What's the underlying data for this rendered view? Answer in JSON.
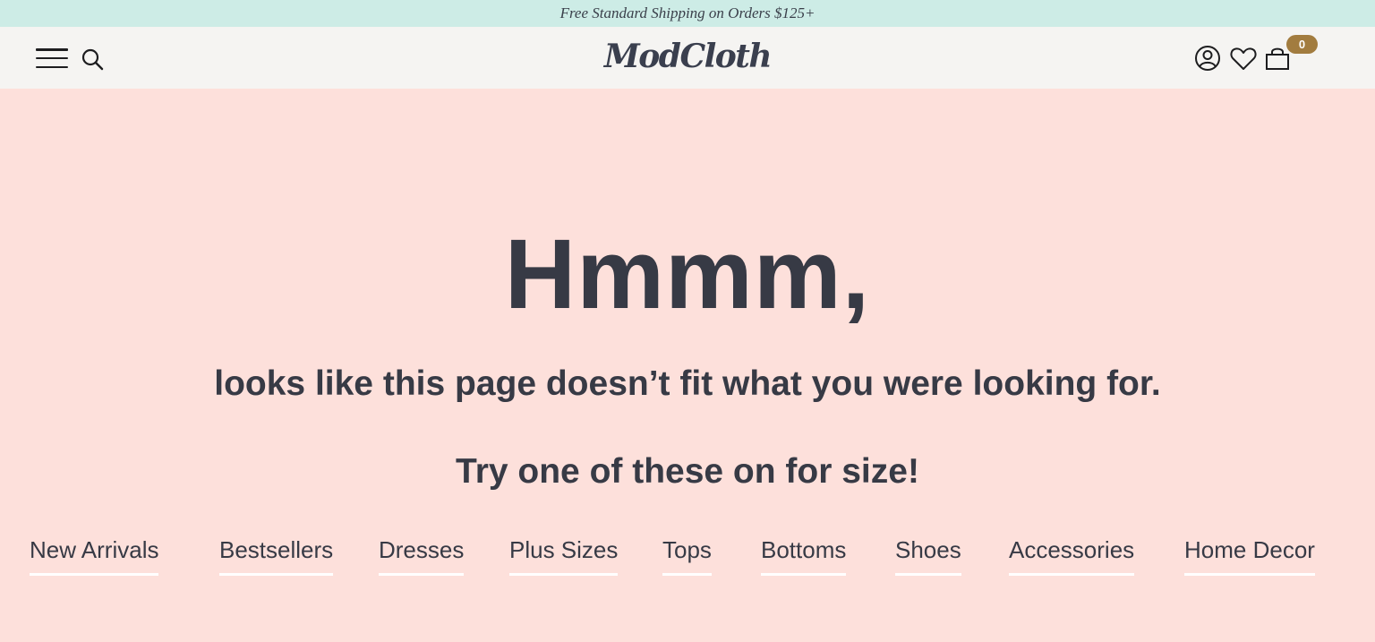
{
  "promo": {
    "text": "Free Standard Shipping on Orders $125+"
  },
  "header": {
    "logo": "ModCloth",
    "cart_count": "0",
    "icons": [
      "menu-icon",
      "search-icon",
      "account-icon",
      "heart-icon",
      "bag-icon"
    ]
  },
  "main": {
    "headline": "Hmmm,",
    "subhead": "looks like this page doesn’t fit what you were looking for.",
    "try_line": "Try one of these on for size!"
  },
  "links": [
    {
      "label": "New Arrivals"
    },
    {
      "label": "Bestsellers"
    },
    {
      "label": "Dresses"
    },
    {
      "label": "Plus Sizes"
    },
    {
      "label": "Tops"
    },
    {
      "label": "Bottoms"
    },
    {
      "label": "Shoes"
    },
    {
      "label": "Accessories"
    },
    {
      "label": "Home Decor"
    }
  ],
  "colors": {
    "promo_bg": "#cdece6",
    "header_bg": "#f5f4f2",
    "page_bg": "#fde0db",
    "text": "#373a45",
    "badge": "#a27c3f"
  }
}
